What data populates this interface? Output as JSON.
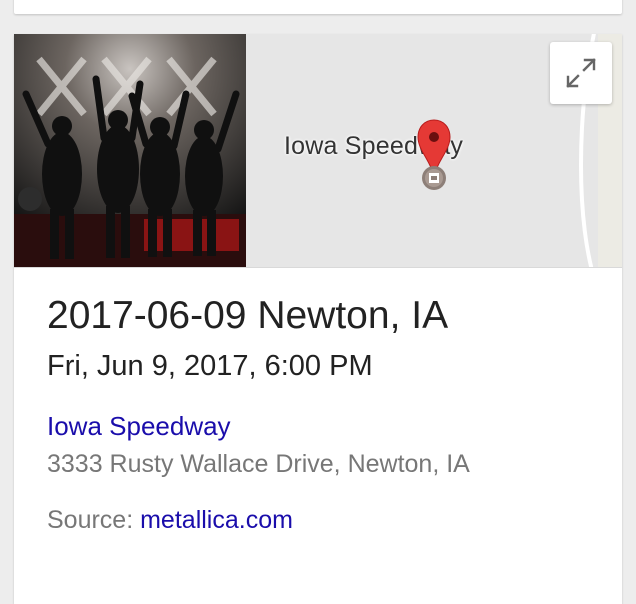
{
  "event": {
    "title": "2017-06-09 Newton, IA",
    "datetime": "Fri, Jun 9, 2017, 6:00 PM",
    "venue_name": "Iowa Speedway",
    "venue_address": "3333 Rusty Wallace Drive, Newton, IA",
    "source_label": "Source: ",
    "source_link": "metallica.com"
  },
  "map": {
    "place_label": "Iowa Speedway",
    "pin_color": "#e53935",
    "expand_icon": "expand-icon"
  },
  "colors": {
    "link": "#1a0dab",
    "secondary_text": "#777777",
    "primary_text": "#222222"
  }
}
